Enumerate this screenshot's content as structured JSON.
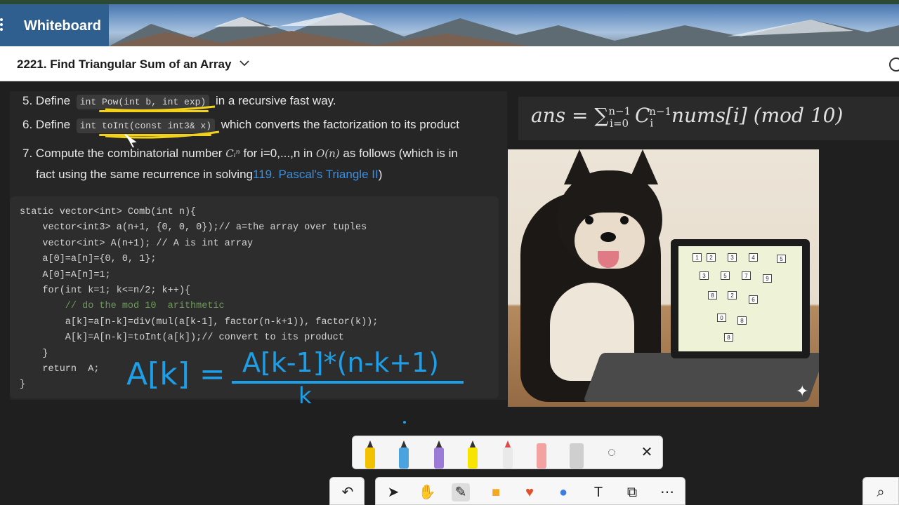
{
  "app": {
    "title": "Whiteboard"
  },
  "header": {
    "title": "2221. Find Triangular Sum of an Array"
  },
  "steps": [
    {
      "num": "5.",
      "prefix": "Define",
      "code": "int Pow(int b, int exp)",
      "suffix": "in a recursive fast way."
    },
    {
      "num": "6.",
      "prefix": "Define",
      "code": "int toInt(const int3& x)",
      "suffix": "which converts the factorization to its product"
    },
    {
      "num": "7.",
      "line1_a": "Compute the combinatorial number",
      "math1": "Cᵢⁿ",
      "line1_b": "for i=0,...,n in",
      "math2": "O(n)",
      "line1_c": "as follows (which is in",
      "line2_a": "fact using the same recurrence in solving",
      "link": "119. Pascal's Triangle II",
      "line2_b": ")"
    }
  ],
  "code": [
    "static vector<int> Comb(int n){",
    "    vector<int3> a(n+1, {0, 0, 0});// a=the array over tuples",
    "    vector<int> A(n+1); // A is int array",
    "    a[0]=a[n]={0, 0, 1};",
    "    A[0]=A[n]=1;",
    "    for(int k=1; k<=n/2; k++){",
    "        // do the mod 10  arithmetic",
    "        a[k]=a[n-k]=div(mul(a[k-1], factor(n-k+1)), factor(k));",
    "        A[k]=A[n-k]=toInt(a[k]);// convert to its product",
    "    }",
    "    return  A;",
    "}"
  ],
  "formula": {
    "text": "ans = ∑",
    "upper": "n−1",
    "lower": "i=0",
    "c": "C",
    "c_sub": "i",
    "c_sup": "n−1",
    "rest": "nums[i]  (mod 10)"
  },
  "handwriting": {
    "lhs": "A[k] =",
    "numerator": "A[k-1]*(n-k+1)",
    "denominator": "k"
  },
  "photo": {
    "alt": "Shiba dog with laptop showing Pascal triangle"
  },
  "pens": [
    {
      "name": "pencil-yellow",
      "color": "#f2c200"
    },
    {
      "name": "pen-blue",
      "color": "#4aa3df"
    },
    {
      "name": "pen-galaxy",
      "color": "#9b7ad8"
    },
    {
      "name": "highlighter-yellow",
      "color": "#f7e400"
    },
    {
      "name": "marker-red",
      "color": "#e04a4a"
    },
    {
      "name": "eraser",
      "color": "#f3a1a1"
    },
    {
      "name": "ruler",
      "color": "#cfcfcf"
    }
  ],
  "icons": {
    "lasso": "lasso-icon",
    "close": "close-icon",
    "undo": "undo-icon",
    "zoom": "zoom-icon"
  }
}
